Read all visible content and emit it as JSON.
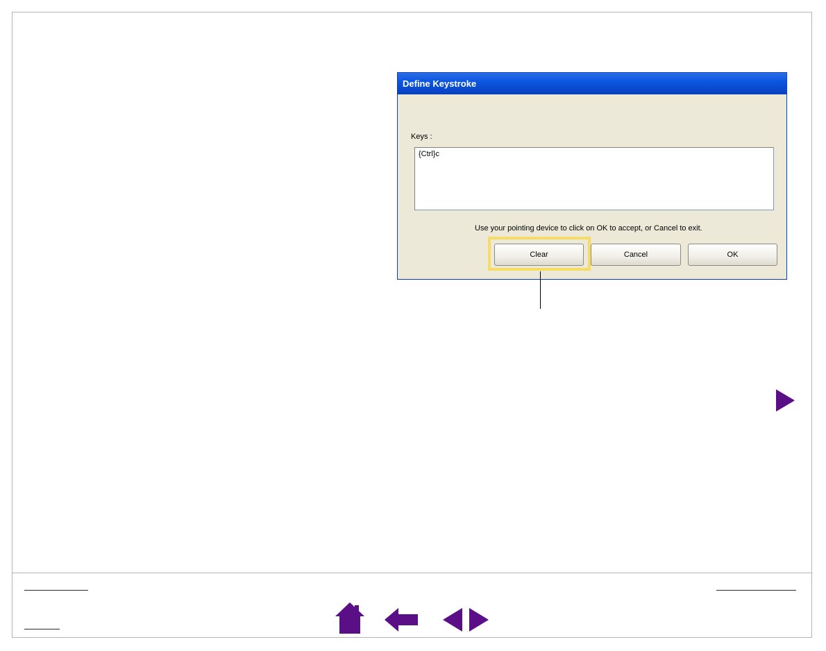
{
  "dialog": {
    "title": "Define Keystroke",
    "keys_label": "Keys :",
    "keys_value": "{Ctrl}c",
    "hint": "Use your pointing device to click on OK to accept, or Cancel to exit.",
    "buttons": {
      "clear": "Clear",
      "cancel": "Cancel",
      "ok": "OK"
    }
  },
  "colors": {
    "nav_purple": "#5b0f86",
    "highlight_yellow": "#f7db63",
    "titlebar_blue": "#0b55e0"
  },
  "icons": {
    "next_page": "triangle-right-icon",
    "home": "home-icon",
    "back": "back-arrow-icon",
    "prev": "prev-page-icon",
    "next": "next-page-icon"
  }
}
